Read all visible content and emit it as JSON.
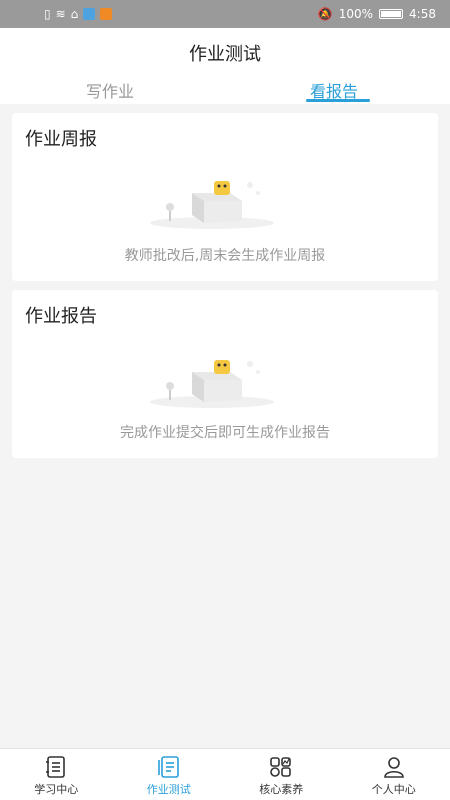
{
  "status_bar": {
    "battery": "100%",
    "time": "4:58"
  },
  "header": {
    "title": "作业测试"
  },
  "tabs": [
    {
      "label": "写作业",
      "active": false
    },
    {
      "label": "看报告",
      "active": true
    }
  ],
  "cards": [
    {
      "title": "作业周报",
      "message": "教师批改后,周末会生成作业周报"
    },
    {
      "title": "作业报告",
      "message": "完成作业提交后即可生成作业报告"
    }
  ],
  "bottom_nav": [
    {
      "label": "学习中心",
      "icon": "notebook-icon",
      "active": false
    },
    {
      "label": "作业测试",
      "icon": "document-icon",
      "active": true
    },
    {
      "label": "核心素养",
      "icon": "grid-icon",
      "active": false
    },
    {
      "label": "个人中心",
      "icon": "person-icon",
      "active": false
    }
  ],
  "colors": {
    "accent": "#2a9fd8",
    "muted_text": "#999999",
    "background": "#f4f4f4"
  }
}
